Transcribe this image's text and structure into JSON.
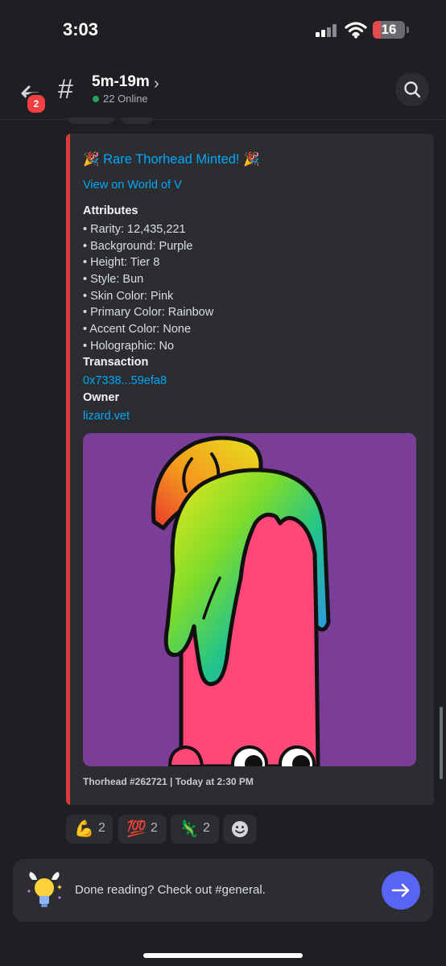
{
  "status_bar": {
    "time": "3:03",
    "battery_level": "16"
  },
  "header": {
    "back_badge": "2",
    "channel_name": "5m-19m",
    "online_text": "22 Online"
  },
  "embed": {
    "title": "Rare Thorhead Minted!",
    "link_text": "View on World of V",
    "attributes_label": "Attributes",
    "attributes": [
      "• Rarity: 12,435,221",
      "• Background: Purple",
      "• Height: Tier 8",
      "• Style: Bun",
      "• Skin Color: Pink",
      "• Primary Color: Rainbow",
      "• Accent Color: None",
      "• Holographic: No"
    ],
    "transaction_label": "Transaction",
    "transaction_value": "0x7338...59efa8",
    "owner_label": "Owner",
    "owner_value": "lizard.vet",
    "footer": "Thorhead #262721 | Today at 2:30 PM",
    "accent_color": "#d83b3b",
    "image_background": "#7a3d98"
  },
  "reactions": [
    {
      "emoji": "💪",
      "count": "2"
    },
    {
      "emoji": "💯",
      "count": "2"
    },
    {
      "emoji": "🦎",
      "count": "2"
    }
  ],
  "bottom_bar": {
    "text": "Done reading? Check out #general."
  },
  "icons": [
    "back-arrow-icon",
    "hash-icon",
    "chevron-right-icon",
    "search-icon",
    "party-popper-icon",
    "add-reaction-icon",
    "lightbulb-icon",
    "arrow-right-icon"
  ]
}
